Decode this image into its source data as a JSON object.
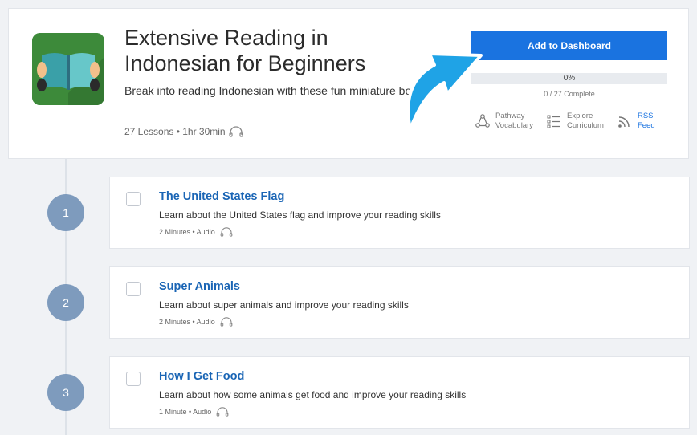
{
  "course": {
    "title": "Extensive Reading in Indonesian for Beginners",
    "subtitle": "Break into reading Indonesian with these fun miniature books.",
    "meta": "27 Lessons • 1hr 30min",
    "audio_icon": "headphones-icon"
  },
  "actions": {
    "add_label": "Add to Dashboard",
    "progress_percent_label": "0%",
    "progress_fraction": 0,
    "complete_label": "0 / 27 Complete"
  },
  "links": [
    {
      "icon": "pathway-icon",
      "line1": "Pathway",
      "line2": "Vocabulary"
    },
    {
      "icon": "curriculum-list-icon",
      "line1": "Explore",
      "line2": "Curriculum"
    },
    {
      "icon": "rss-icon",
      "line1": "RSS",
      "line2": "Feed"
    }
  ],
  "lessons": [
    {
      "number": "1",
      "title": "The United States Flag",
      "description": "Learn about the United States flag and improve your reading skills",
      "meta": "2 Minutes • Audio"
    },
    {
      "number": "2",
      "title": "Super Animals",
      "description": "Learn about super animals and improve your reading skills",
      "meta": "2 Minutes • Audio"
    },
    {
      "number": "3",
      "title": "How I Get Food",
      "description": "Learn about how some animals get food and improve your reading skills",
      "meta": "1 Minute • Audio"
    }
  ],
  "colors": {
    "accent": "#1a73e0",
    "link": "#1a65b5",
    "timeline_circle": "#7e9bbd",
    "arrow": "#1fa3e6"
  }
}
